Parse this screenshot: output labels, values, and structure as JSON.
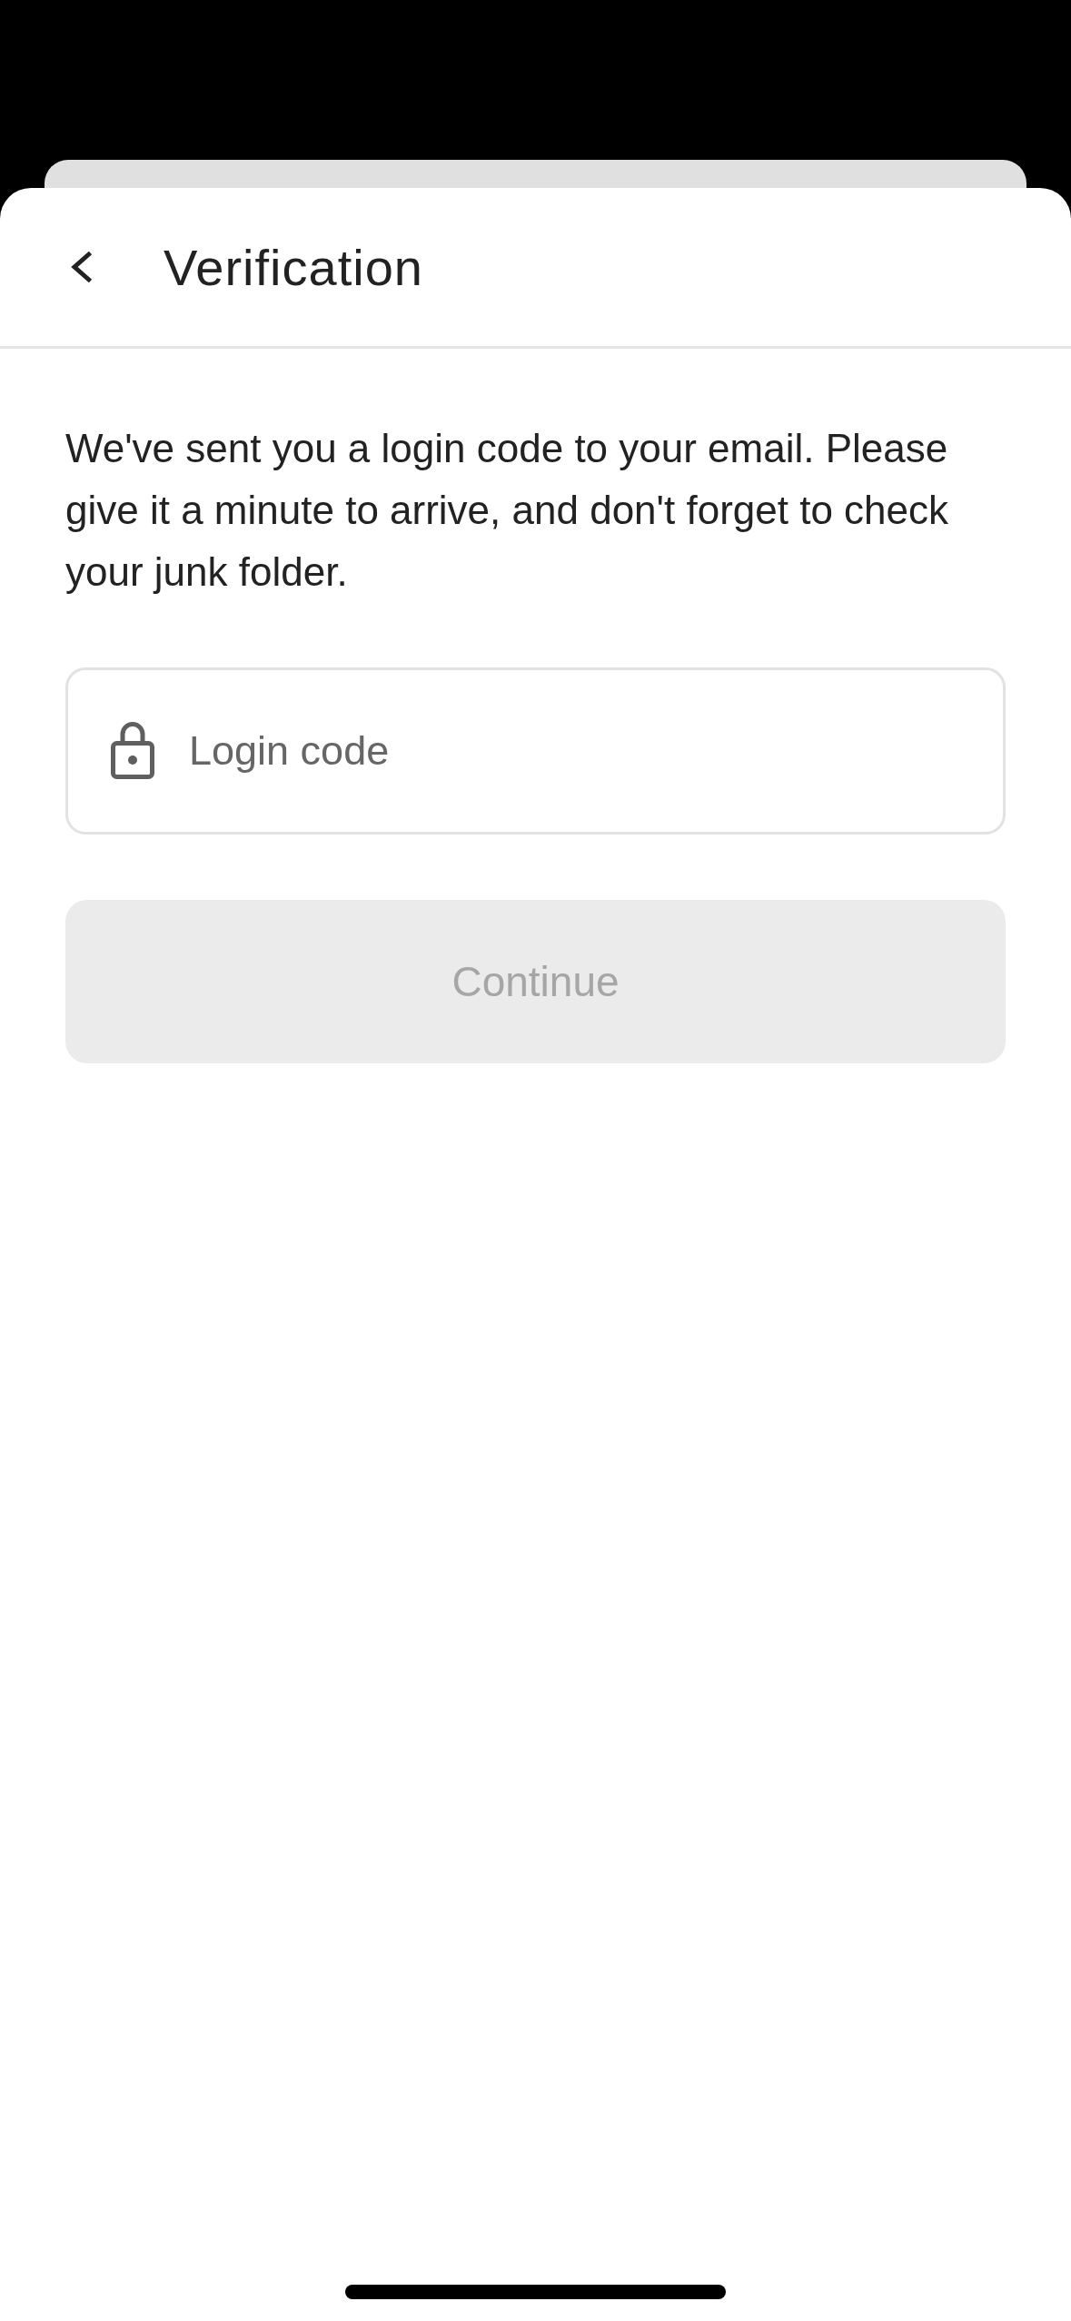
{
  "header": {
    "title": "Verification"
  },
  "message": "We've sent you a login code to your email. Please give it a minute to arrive, and don't forget to check your junk folder.",
  "login_field": {
    "placeholder": "Login code"
  },
  "continue_button": {
    "label": "Continue",
    "disabled": true
  }
}
